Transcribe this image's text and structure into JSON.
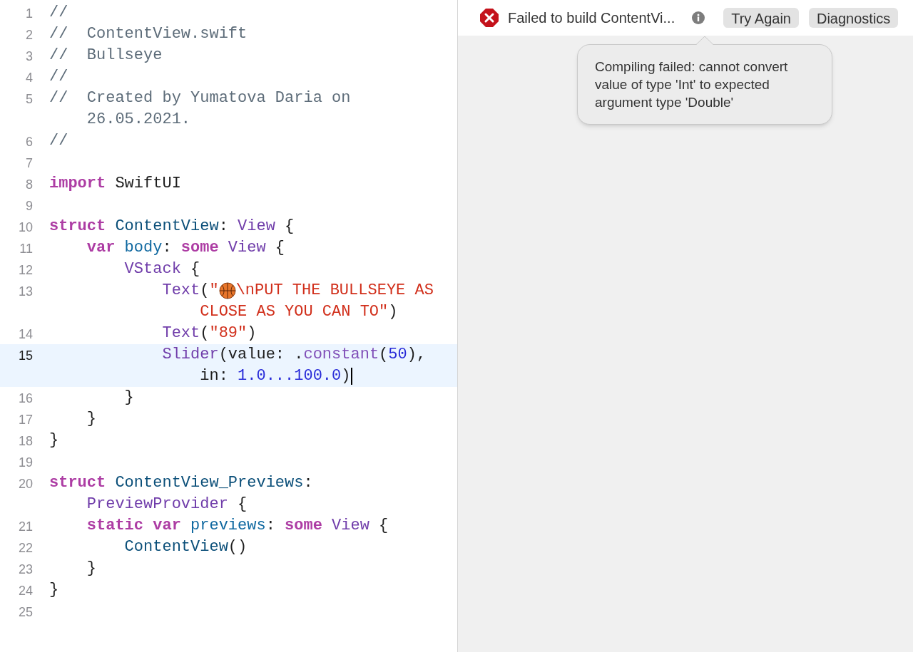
{
  "editor": {
    "lines": [
      {
        "number": "1",
        "current": false,
        "rows": [
          {
            "tokens": [
              {
                "kind": "comment",
                "text": "//"
              }
            ]
          }
        ]
      },
      {
        "number": "2",
        "current": false,
        "rows": [
          {
            "tokens": [
              {
                "kind": "comment",
                "text": "//  ContentView.swift"
              }
            ]
          }
        ]
      },
      {
        "number": "3",
        "current": false,
        "rows": [
          {
            "tokens": [
              {
                "kind": "comment",
                "text": "//  Bullseye"
              }
            ]
          }
        ]
      },
      {
        "number": "4",
        "current": false,
        "rows": [
          {
            "tokens": [
              {
                "kind": "comment",
                "text": "//"
              }
            ]
          }
        ]
      },
      {
        "number": "5",
        "current": false,
        "rows": [
          {
            "tokens": [
              {
                "kind": "comment",
                "text": "//  Created by Yumatova Daria on"
              }
            ]
          },
          {
            "tokens": [
              {
                "kind": "comment",
                "text": "    26.05.2021."
              }
            ]
          }
        ]
      },
      {
        "number": "6",
        "current": false,
        "rows": [
          {
            "tokens": [
              {
                "kind": "comment",
                "text": "//"
              }
            ]
          }
        ]
      },
      {
        "number": "7",
        "current": false,
        "rows": [
          {
            "tokens": []
          }
        ]
      },
      {
        "number": "8",
        "current": false,
        "rows": [
          {
            "tokens": [
              {
                "kind": "keyword",
                "text": "import"
              },
              {
                "kind": "plain",
                "text": " SwiftUI"
              }
            ]
          }
        ]
      },
      {
        "number": "9",
        "current": false,
        "rows": [
          {
            "tokens": []
          }
        ]
      },
      {
        "number": "10",
        "current": false,
        "rows": [
          {
            "tokens": [
              {
                "kind": "keyword",
                "text": "struct"
              },
              {
                "kind": "decl",
                "text": " ContentView"
              },
              {
                "kind": "plain",
                "text": ": "
              },
              {
                "kind": "type",
                "text": "View"
              },
              {
                "kind": "plain",
                "text": " {"
              }
            ]
          }
        ]
      },
      {
        "number": "11",
        "current": false,
        "rows": [
          {
            "tokens": [
              {
                "kind": "keyword",
                "text": "    var"
              },
              {
                "kind": "property",
                "text": " body"
              },
              {
                "kind": "plain",
                "text": ": "
              },
              {
                "kind": "keyword",
                "text": "some"
              },
              {
                "kind": "type",
                "text": " View"
              },
              {
                "kind": "plain",
                "text": " {"
              }
            ]
          }
        ]
      },
      {
        "number": "12",
        "current": false,
        "rows": [
          {
            "tokens": [
              {
                "kind": "type",
                "text": "        VStack"
              },
              {
                "kind": "plain",
                "text": " {"
              }
            ]
          }
        ]
      },
      {
        "number": "13",
        "current": false,
        "rows": [
          {
            "tokens": [
              {
                "kind": "type",
                "text": "            Text"
              },
              {
                "kind": "plain",
                "text": "("
              },
              {
                "kind": "string",
                "text": "\""
              },
              {
                "kind": "ball-icon"
              },
              {
                "kind": "string",
                "text": "\\nPUT THE BULLSEYE AS"
              }
            ]
          },
          {
            "tokens": [
              {
                "kind": "string",
                "text": "                CLOSE AS YOU CAN TO\""
              },
              {
                "kind": "plain",
                "text": ")"
              }
            ]
          }
        ]
      },
      {
        "number": "14",
        "current": false,
        "rows": [
          {
            "tokens": [
              {
                "kind": "type",
                "text": "            Text"
              },
              {
                "kind": "plain",
                "text": "("
              },
              {
                "kind": "string",
                "text": "\"89\""
              },
              {
                "kind": "plain",
                "text": ")"
              }
            ]
          }
        ]
      },
      {
        "number": "15",
        "current": true,
        "rows": [
          {
            "tokens": [
              {
                "kind": "type",
                "text": "            Slider"
              },
              {
                "kind": "plain",
                "text": "(value: ."
              },
              {
                "kind": "member",
                "text": "constant"
              },
              {
                "kind": "plain",
                "text": "("
              },
              {
                "kind": "number",
                "text": "50"
              },
              {
                "kind": "plain",
                "text": "),"
              }
            ]
          },
          {
            "tokens": [
              {
                "kind": "plain",
                "text": "                in: "
              },
              {
                "kind": "number",
                "text": "1.0...100.0"
              },
              {
                "kind": "plain",
                "text": ")"
              }
            ]
          }
        ]
      },
      {
        "number": "16",
        "current": false,
        "rows": [
          {
            "tokens": [
              {
                "kind": "plain",
                "text": "        }"
              }
            ]
          }
        ]
      },
      {
        "number": "17",
        "current": false,
        "rows": [
          {
            "tokens": [
              {
                "kind": "plain",
                "text": "    }"
              }
            ]
          }
        ]
      },
      {
        "number": "18",
        "current": false,
        "rows": [
          {
            "tokens": [
              {
                "kind": "plain",
                "text": "}"
              }
            ]
          }
        ]
      },
      {
        "number": "19",
        "current": false,
        "rows": [
          {
            "tokens": []
          }
        ]
      },
      {
        "number": "20",
        "current": false,
        "rows": [
          {
            "tokens": [
              {
                "kind": "keyword",
                "text": "struct"
              },
              {
                "kind": "decl",
                "text": " ContentView_Previews"
              },
              {
                "kind": "plain",
                "text": ":"
              }
            ]
          },
          {
            "tokens": [
              {
                "kind": "type",
                "text": "    PreviewProvider"
              },
              {
                "kind": "plain",
                "text": " {"
              }
            ]
          }
        ]
      },
      {
        "number": "21",
        "current": false,
        "rows": [
          {
            "tokens": [
              {
                "kind": "keyword",
                "text": "    static var"
              },
              {
                "kind": "property",
                "text": " previews"
              },
              {
                "kind": "plain",
                "text": ": "
              },
              {
                "kind": "keyword",
                "text": "some"
              },
              {
                "kind": "type",
                "text": " View"
              },
              {
                "kind": "plain",
                "text": " {"
              }
            ]
          }
        ]
      },
      {
        "number": "22",
        "current": false,
        "rows": [
          {
            "tokens": [
              {
                "kind": "decl",
                "text": "        ContentView"
              },
              {
                "kind": "plain",
                "text": "()"
              }
            ]
          }
        ]
      },
      {
        "number": "23",
        "current": false,
        "rows": [
          {
            "tokens": [
              {
                "kind": "plain",
                "text": "    }"
              }
            ]
          }
        ]
      },
      {
        "number": "24",
        "current": false,
        "rows": [
          {
            "tokens": [
              {
                "kind": "plain",
                "text": "}"
              }
            ]
          }
        ]
      },
      {
        "number": "25",
        "current": false,
        "rows": [
          {
            "tokens": []
          }
        ]
      }
    ]
  },
  "preview": {
    "status": "Failed to build ContentVi...",
    "buttons": [
      "Try Again",
      "Diagnostics"
    ],
    "tooltip": "Compiling failed: cannot convert value of type 'Int' to expected argument type 'Double'"
  }
}
